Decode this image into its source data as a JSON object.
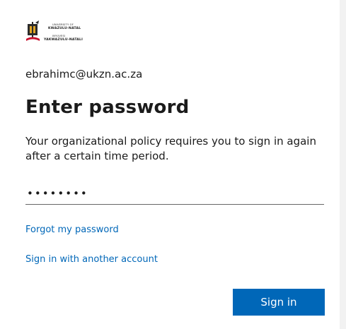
{
  "logo": {
    "line1": "UNIVERSITY OF",
    "line2": "KWAZULU-NATAL",
    "line3": "INYUVESI",
    "line4": "YAKWAZULU-NATALI"
  },
  "account": {
    "email": "ebrahimc@ukzn.ac.za"
  },
  "header": {
    "title": "Enter password"
  },
  "message": {
    "text": "Your organizational policy requires you to sign in again after a certain time period."
  },
  "password": {
    "value": "••••••••"
  },
  "links": {
    "forgot": "Forgot my password",
    "another_account": "Sign in with another account"
  },
  "actions": {
    "sign_in": "Sign in"
  },
  "colors": {
    "accent": "#0067b8",
    "logo_red": "#c8102e",
    "logo_gold": "#e0a526",
    "text": "#1b1b1b"
  }
}
